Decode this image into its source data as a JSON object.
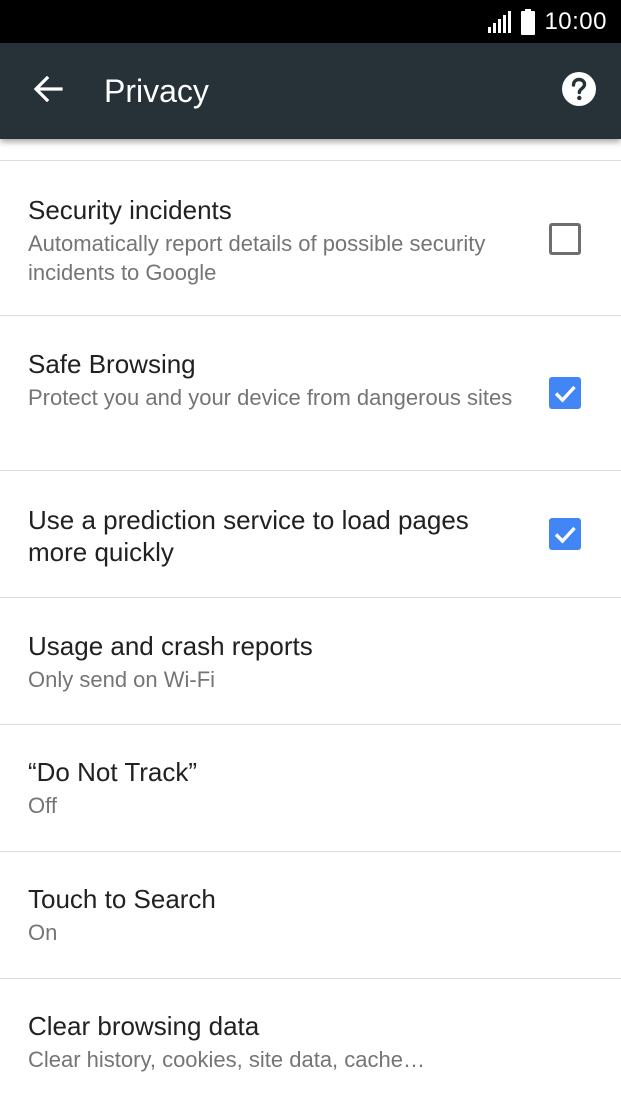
{
  "status_bar": {
    "time": "10:00"
  },
  "toolbar": {
    "title": "Privacy",
    "back_icon": "arrow-back-icon",
    "help_icon": "help-circle-icon"
  },
  "settings": [
    {
      "title": "Security incidents",
      "summary": "Automatically report details of possible security incidents to Google",
      "checked": false
    },
    {
      "title": "Safe Browsing",
      "summary": "Protect you and your device from dangerous sites",
      "checked": true
    },
    {
      "title": "Use a prediction service to load pages more quickly",
      "checked": true
    },
    {
      "title": "Usage and crash reports",
      "summary": "Only send on Wi-Fi"
    },
    {
      "title": "“Do Not Track”",
      "summary": "Off"
    },
    {
      "title": "Touch to Search",
      "summary": "On"
    },
    {
      "title": "Clear browsing data",
      "summary": "Clear history, cookies, site data, cache…"
    }
  ],
  "colors": {
    "toolbar": "#263238",
    "checkbox_checked": "#4285f4",
    "summary_text": "#757575"
  }
}
